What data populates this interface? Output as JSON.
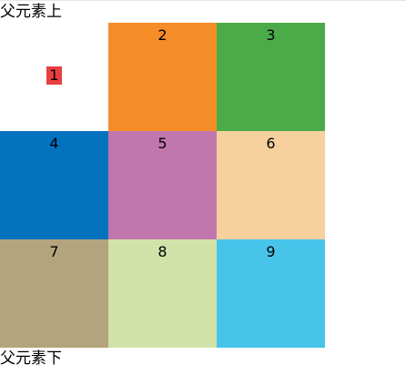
{
  "parent_top_text": "父元素上",
  "parent_bottom_text": "父元素下",
  "cells": [
    {
      "label": "1",
      "color": "#e84040"
    },
    {
      "label": "2",
      "color": "#f58d29"
    },
    {
      "label": "3",
      "color": "#4aab48"
    },
    {
      "label": "4",
      "color": "#0373c0"
    },
    {
      "label": "5",
      "color": "#c077ad"
    },
    {
      "label": "6",
      "color": "#f7d19d"
    },
    {
      "label": "7",
      "color": "#b4a47e"
    },
    {
      "label": "8",
      "color": "#d1e2a9"
    },
    {
      "label": "9",
      "color": "#48c4ea"
    }
  ]
}
